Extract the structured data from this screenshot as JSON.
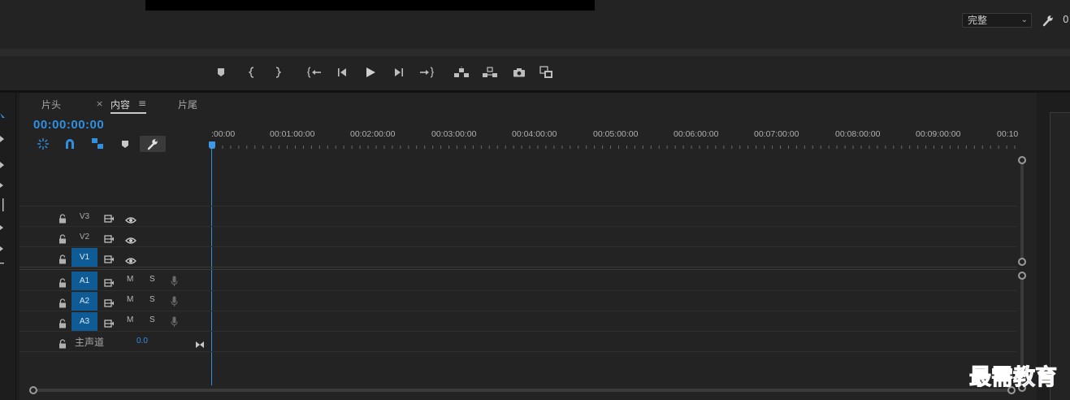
{
  "monitor": {
    "quality": "完整",
    "quality_options_icon": "chevron-down-icon",
    "tail_text": "0"
  },
  "transport": {
    "buttons": [
      "add-marker",
      "mark-in",
      "mark-out",
      "go-to-in",
      "step-back",
      "play",
      "step-forward",
      "go-to-out",
      "lift",
      "extract",
      "export-frame",
      "comparison-view"
    ]
  },
  "timeline": {
    "tabs": [
      {
        "label": "片头",
        "active": false
      },
      {
        "label": "内容",
        "active": true
      },
      {
        "label": "片尾",
        "active": false
      }
    ],
    "tab_close": "×",
    "tab_menu": "≡",
    "timecode": "00:00:00:00",
    "ruler_labels": [
      ":00:00",
      "00:01:00:00",
      "00:02:00:00",
      "00:03:00:00",
      "00:04:00:00",
      "00:05:00:00",
      "00:06:00:00",
      "00:07:00:00",
      "00:08:00:00",
      "00:09:00:00",
      "00:10"
    ],
    "video_tracks": [
      {
        "name": "V3",
        "targeted": false
      },
      {
        "name": "V2",
        "targeted": false
      },
      {
        "name": "V1",
        "targeted": true
      }
    ],
    "audio_tracks": [
      {
        "name": "A1",
        "mute": "M",
        "solo": "S"
      },
      {
        "name": "A2",
        "mute": "M",
        "solo": "S"
      },
      {
        "name": "A3",
        "mute": "M",
        "solo": "S"
      }
    ],
    "master": {
      "label": "主声道",
      "value": "0.0"
    }
  },
  "colors": {
    "accent": "#2f8fe0",
    "track_target": "#0f5b95",
    "panel_bg": "#232323"
  },
  "watermark": "最需教育"
}
